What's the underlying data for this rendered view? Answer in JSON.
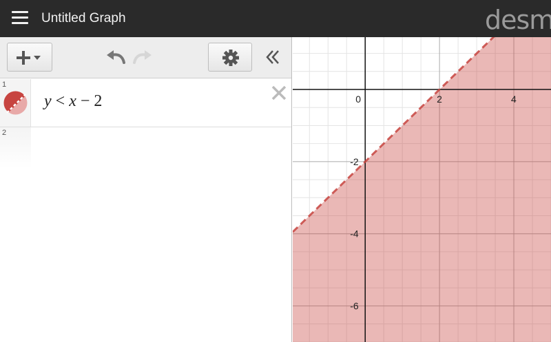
{
  "header": {
    "title": "Untitled Graph",
    "logo": "desmos"
  },
  "expressions": [
    {
      "index": "1",
      "latex_parts": [
        "y",
        "<",
        "x",
        "−",
        "2"
      ],
      "color": "#c74440"
    },
    {
      "index": "2"
    }
  ],
  "graph": {
    "x_range": [
      -1.95,
      5.0
    ],
    "y_range": [
      -7.0,
      1.45
    ],
    "x_tick_labels": [
      "0",
      "2",
      "4"
    ],
    "y_tick_labels": [
      "-2",
      "-4",
      "-6"
    ],
    "inequality": "y < x - 2",
    "boundary_style": "dashed",
    "shade_color": "#c74440"
  }
}
